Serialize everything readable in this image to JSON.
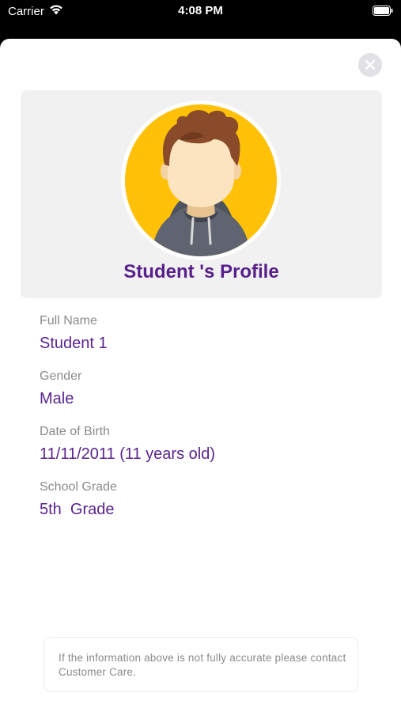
{
  "status_bar": {
    "carrier": "Carrier",
    "time": "4:08 PM",
    "wifi_icon": "wifi-icon",
    "battery_icon": "battery-icon"
  },
  "colors": {
    "accent": "#57208a",
    "card_bg": "#f1f1f2",
    "avatar_bg": "#ffc107"
  },
  "profile": {
    "title": "Student 's Profile",
    "avatar_icon": "student-avatar-icon"
  },
  "close_icon": "close-icon",
  "fields": [
    {
      "label": "Full Name",
      "value": "Student 1"
    },
    {
      "label": "Gender",
      "value": "Male"
    },
    {
      "label": "Date of Birth",
      "value": "11/11/2011 (11 years old)"
    },
    {
      "label": "School Grade",
      "value": "5th  Grade"
    }
  ],
  "notice": {
    "text": "If the information above is not fully accurate please contact Customer Care."
  }
}
